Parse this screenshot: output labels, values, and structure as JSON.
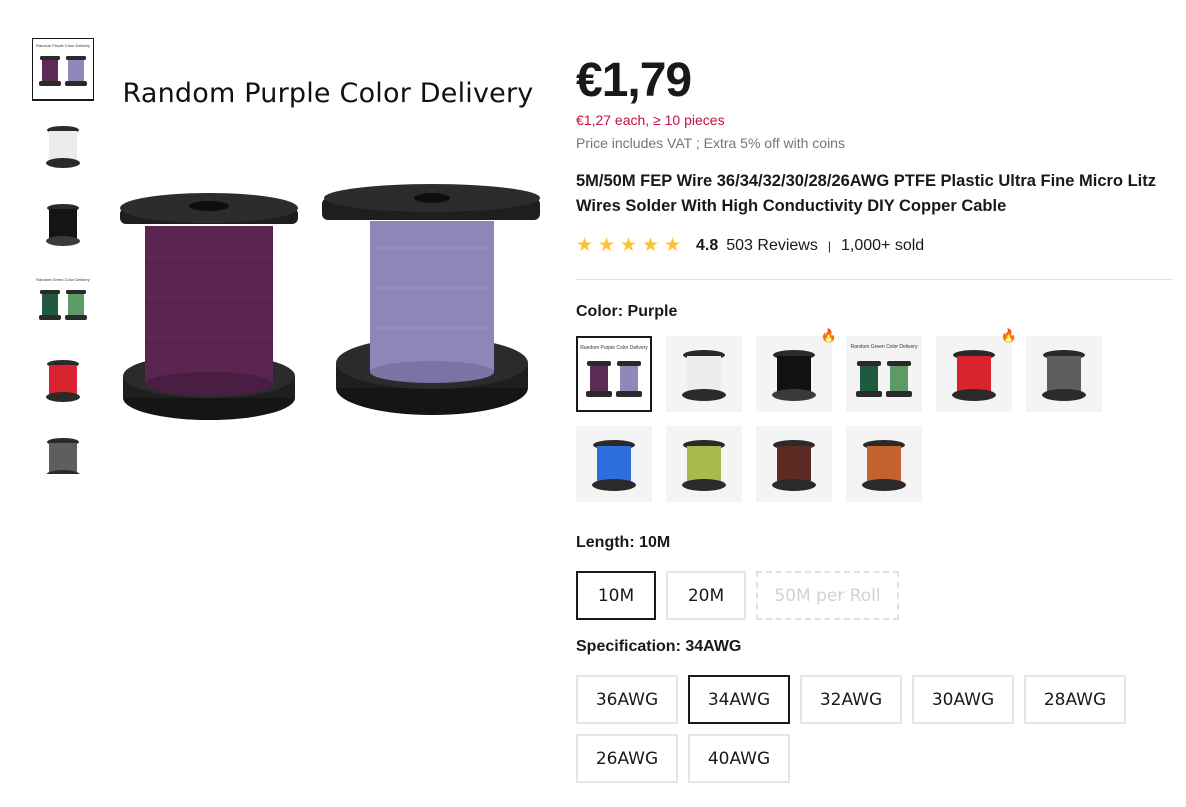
{
  "gallery": {
    "caption": "Random Purple Color Delivery",
    "thumbnails": [
      {
        "name": "purple",
        "caption": "Random Purple Color Delivery"
      },
      {
        "name": "white",
        "caption": ""
      },
      {
        "name": "black",
        "caption": ""
      },
      {
        "name": "green",
        "caption": "Random Green Color Delivery"
      },
      {
        "name": "red",
        "caption": ""
      },
      {
        "name": "gray",
        "caption": ""
      }
    ]
  },
  "product": {
    "price": "€1,79",
    "bulk_price": "€1,27 each, ≥ 10 pieces",
    "vat_note": "Price includes VAT ; Extra 5% off with coins",
    "title": "5M/50M FEP Wire 36/34/32/30/28/26AWG PTFE Plastic Ultra Fine Micro Litz Wires Solder With High Conductivity DIY Copper Cable",
    "rating": "4.8",
    "reviews": "503 Reviews",
    "sold": "1,000+ sold"
  },
  "colors": {
    "accent": "#c4103f",
    "star": "#fdc42d"
  },
  "color_option": {
    "label": "Color: Purple",
    "swatches": [
      {
        "name": "purple",
        "caption": "Random Purple Color Delivery",
        "hot": false,
        "selected": true
      },
      {
        "name": "white",
        "caption": "",
        "hot": false,
        "selected": false
      },
      {
        "name": "black",
        "caption": "",
        "hot": true,
        "selected": false
      },
      {
        "name": "green",
        "caption": "Random Green Color Delivery",
        "hot": false,
        "selected": false
      },
      {
        "name": "red",
        "caption": "",
        "hot": true,
        "selected": false
      },
      {
        "name": "gray",
        "caption": "",
        "hot": false,
        "selected": false
      },
      {
        "name": "blue",
        "caption": "",
        "hot": false,
        "selected": false
      },
      {
        "name": "yellow-green",
        "caption": "",
        "hot": false,
        "selected": false
      },
      {
        "name": "brown",
        "caption": "",
        "hot": false,
        "selected": false
      },
      {
        "name": "orange",
        "caption": "",
        "hot": false,
        "selected": false
      }
    ]
  },
  "length_option": {
    "label": "Length: 10M",
    "options": [
      {
        "label": "10M",
        "state": "selected"
      },
      {
        "label": "20M",
        "state": "normal"
      },
      {
        "label": "50M per Roll",
        "state": "disabled"
      }
    ]
  },
  "spec_option": {
    "label": "Specification: 34AWG",
    "options": [
      {
        "label": "36AWG",
        "state": "normal"
      },
      {
        "label": "34AWG",
        "state": "selected"
      },
      {
        "label": "32AWG",
        "state": "normal"
      },
      {
        "label": "30AWG",
        "state": "normal"
      },
      {
        "label": "28AWG",
        "state": "normal"
      },
      {
        "label": "26AWG",
        "state": "normal"
      },
      {
        "label": "40AWG",
        "state": "normal"
      }
    ]
  }
}
